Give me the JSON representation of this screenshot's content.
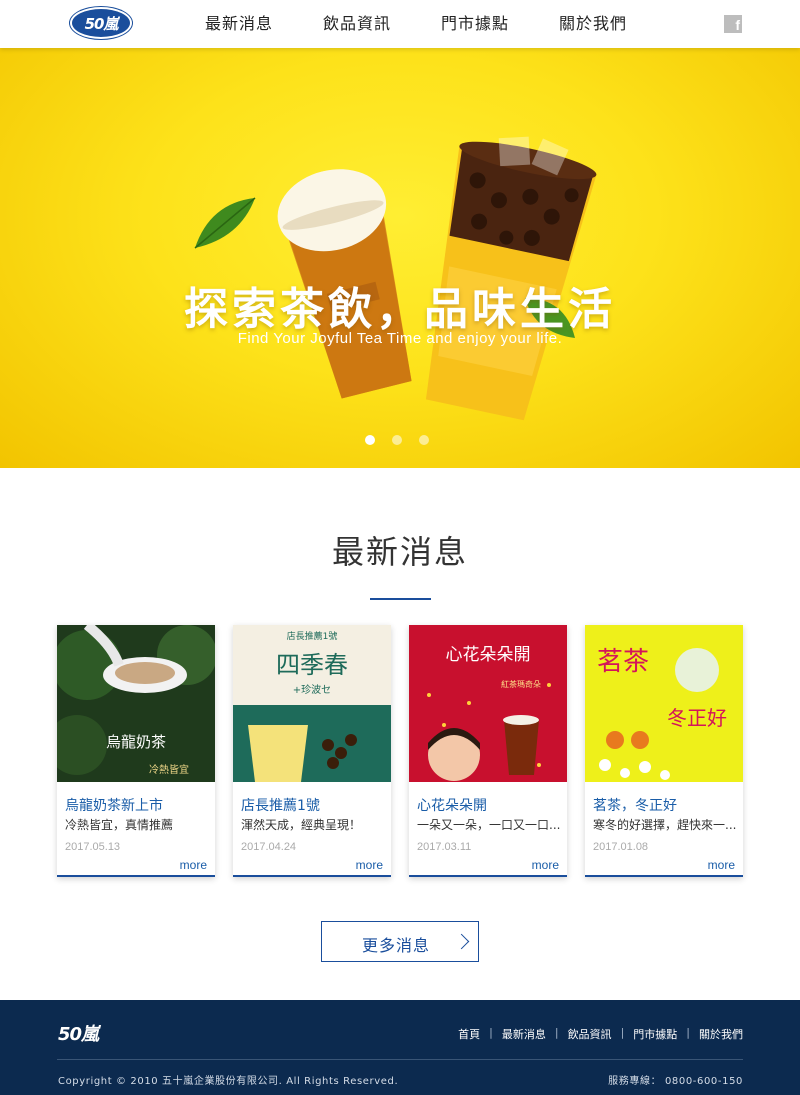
{
  "header": {
    "logo_text": "50嵐",
    "nav": [
      "最新消息",
      "飲品資訊",
      "門市據點",
      "關於我們"
    ],
    "social_icon": "facebook-icon"
  },
  "hero": {
    "title": "探索茶飲，品味生活",
    "subtitle": "Find Your Joyful Tea Time and enjoy your life.",
    "slide_count": 3,
    "active_slide": 1,
    "colors": {
      "background": "#fde21a"
    }
  },
  "news": {
    "title": "最新消息",
    "cards": [
      {
        "title": "烏龍奶茶新上市",
        "desc": "冷熱皆宜，真情推薦",
        "date": "2017.05.13",
        "more": "more",
        "image_caption": "烏龍奶茶",
        "image_sub": "冷熱皆宜"
      },
      {
        "title": "店長推薦1號",
        "desc": "渾然天成，經典呈現！",
        "date": "2017.04.24",
        "more": "more",
        "image_caption": "四季春",
        "image_sub": "+珍波セ",
        "image_top": "店長推薦1號"
      },
      {
        "title": "心花朵朵開",
        "desc": "一朵又一朵，一口又一口...",
        "date": "2017.03.11",
        "more": "more",
        "image_caption": "心花朵朵開",
        "image_sub": "紅茶瑪奇朵"
      },
      {
        "title": "茗茶，冬正好",
        "desc": "寒冬的好選擇，趕快來一...",
        "date": "2017.01.08",
        "more": "more",
        "image_caption": "茗茶",
        "image_sub": "冬正好"
      }
    ],
    "more_button": "更多消息"
  },
  "footer": {
    "logo_text": "50嵐",
    "links": [
      "首頁",
      "最新消息",
      "飲品資訊",
      "門市據點",
      "關於我們"
    ],
    "copyright": "Copyright © 2010 五十嵐企業股份有限公司. All Rights Reserved.",
    "service": "服務專線： 0800-600-150"
  },
  "colors": {
    "brand_blue": "#1a4e9c",
    "footer_bg": "#0c2a4f"
  }
}
